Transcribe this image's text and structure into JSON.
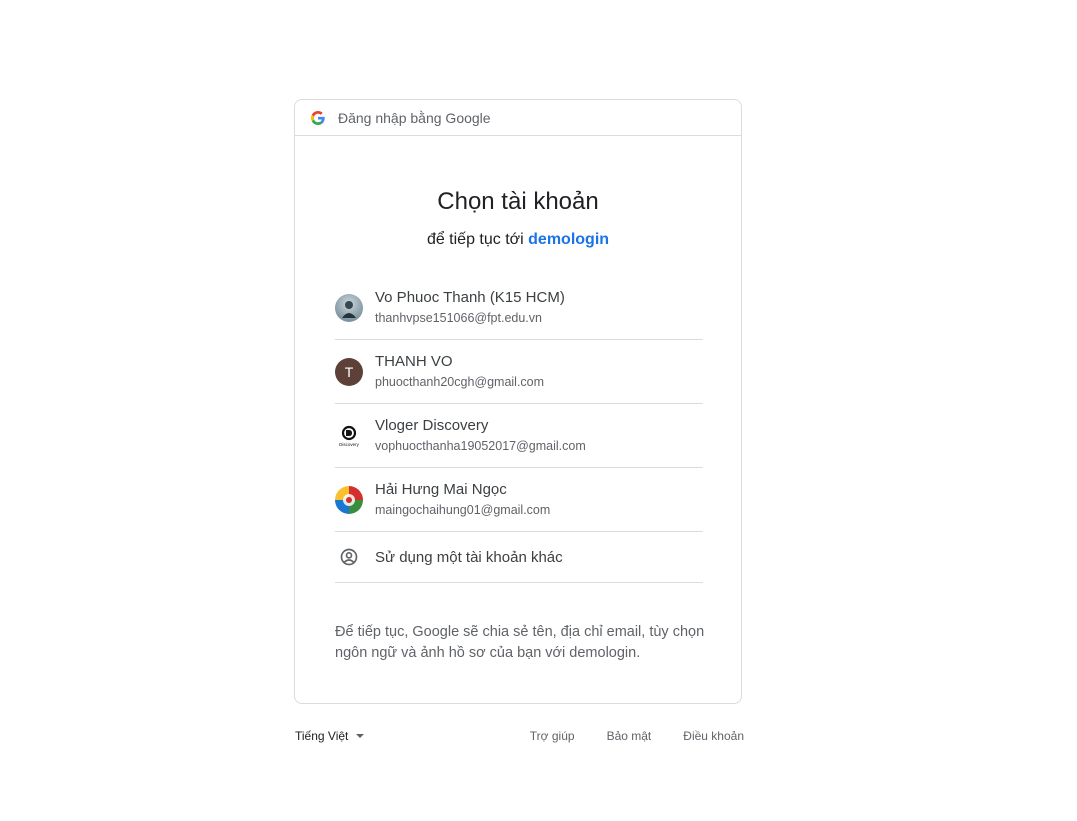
{
  "header": {
    "text": "Đăng nhập bằng Google"
  },
  "main": {
    "title": "Chọn tài khoản",
    "subtitle_prefix": "để tiếp tục tới",
    "app_name": "demologin"
  },
  "accounts": [
    {
      "name": "Vo Phuoc Thanh (K15 HCM)",
      "email": "thanhvpse151066@fpt.edu.vn",
      "avatar": "photo"
    },
    {
      "name": "THANH VO",
      "email": "phuocthanh20cgh@gmail.com",
      "avatar": "letter",
      "avatar_letter": "T",
      "avatar_color": "#5d4037"
    },
    {
      "name": "Vloger Discovery",
      "email": "vophuocthanha19052017@gmail.com",
      "avatar": "logo",
      "avatar_text": "Discovery"
    },
    {
      "name": "Hải Hưng Mai Ngọc",
      "email": "maingochaihung01@gmail.com",
      "avatar": "flag"
    }
  ],
  "other_account": {
    "label": "Sử dụng một tài khoản khác",
    "icon": "account-circle-icon"
  },
  "notice": {
    "text": "Để tiếp tục, Google sẽ chia sẻ tên, địa chỉ email, tùy chọn ngôn ngữ và ảnh hồ sơ của bạn với demologin."
  },
  "footer": {
    "language": "Tiếng Việt",
    "links": [
      "Trợ giúp",
      "Bảo mật",
      "Điều khoản"
    ]
  },
  "colors": {
    "accent": "#1a73e8",
    "border": "#dadce0",
    "text_secondary": "#5f6368"
  }
}
